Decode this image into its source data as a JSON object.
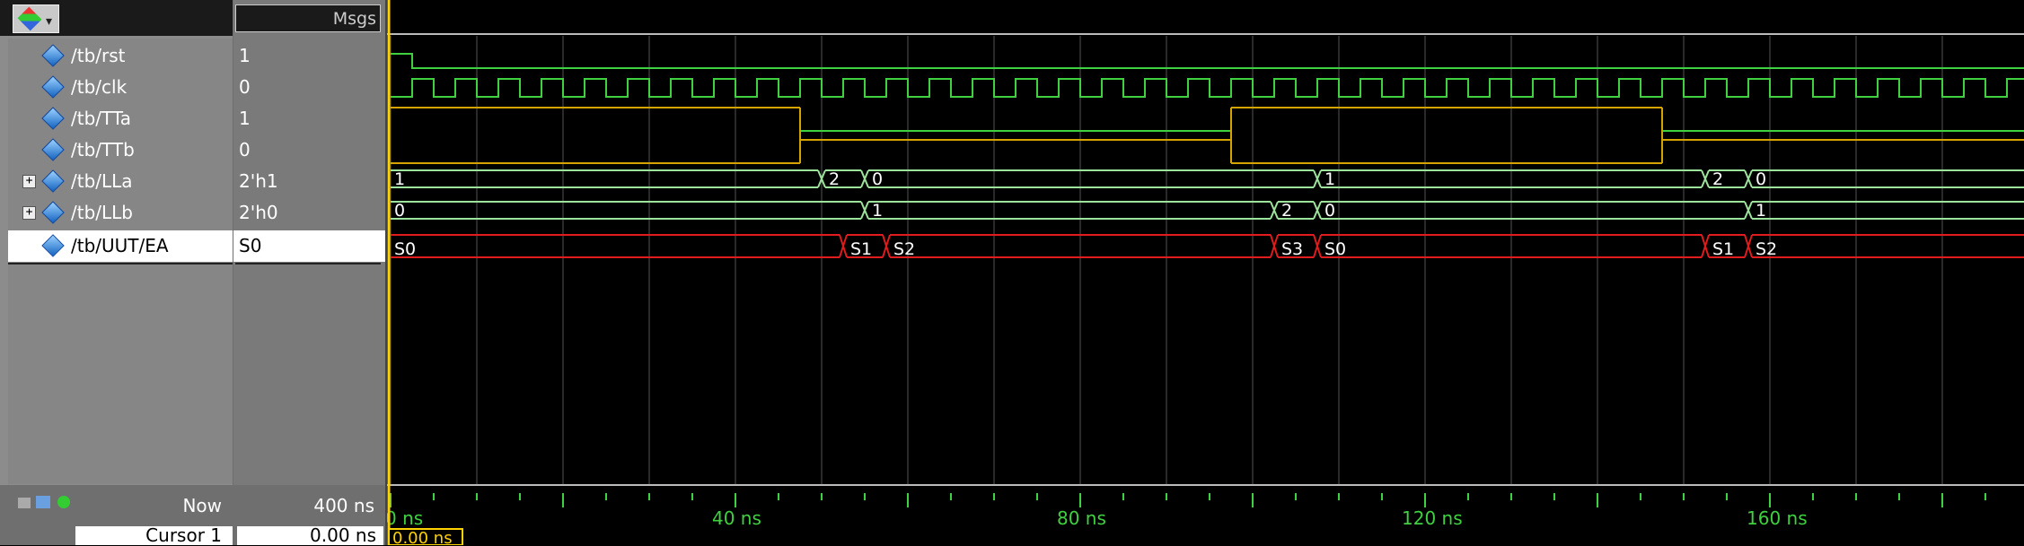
{
  "toolbar": {
    "icon": "wave-tool-icon"
  },
  "value_header": "Msgs",
  "signals": [
    {
      "name": "/tb/rst",
      "value": "1",
      "expandable": false
    },
    {
      "name": "/tb/clk",
      "value": "0",
      "expandable": false
    },
    {
      "name": "/tb/TTa",
      "value": "1",
      "expandable": false
    },
    {
      "name": "/tb/TTb",
      "value": "0",
      "expandable": false
    },
    {
      "name": "/tb/LLa",
      "value": "2'h1",
      "expandable": true
    },
    {
      "name": "/tb/LLb",
      "value": "2'h0",
      "expandable": true
    },
    {
      "name": "/tb/UUT/EA",
      "value": "S0",
      "expandable": false,
      "selected": true
    }
  ],
  "bus_labels": {
    "LLa": [
      {
        "t": 0,
        "v": "1"
      },
      {
        "t": 50,
        "v": "2"
      },
      {
        "t": 55,
        "v": "0"
      },
      {
        "t": 107.5,
        "v": "1"
      },
      {
        "t": 152.5,
        "v": "2"
      },
      {
        "t": 157.5,
        "v": "0"
      }
    ],
    "LLb": [
      {
        "t": 0,
        "v": "0"
      },
      {
        "t": 55,
        "v": "1"
      },
      {
        "t": 102.5,
        "v": "2"
      },
      {
        "t": 107.5,
        "v": "0"
      },
      {
        "t": 157.5,
        "v": "1"
      }
    ],
    "EA": [
      {
        "t": 0,
        "v": "S0"
      },
      {
        "t": 52.5,
        "v": "S1"
      },
      {
        "t": 57.5,
        "v": "S2"
      },
      {
        "t": 102.5,
        "v": "S3"
      },
      {
        "t": 107.5,
        "v": "S0"
      },
      {
        "t": 152.5,
        "v": "S1"
      },
      {
        "t": 157.5,
        "v": "S2"
      }
    ]
  },
  "status": {
    "now_label": "Now",
    "now_value": "400 ns",
    "cursor_label": "Cursor 1",
    "cursor_value": "0.00 ns",
    "cursor_time_tag": "0.00 ns"
  },
  "timeline": {
    "unit": "ns",
    "major_ticks": [
      {
        "t": 0,
        "label": "0 ns"
      },
      {
        "t": 40,
        "label": "40 ns"
      },
      {
        "t": 80,
        "label": "80 ns"
      },
      {
        "t": 120,
        "label": "120 ns"
      },
      {
        "t": 160,
        "label": "160 ns"
      }
    ]
  },
  "colors": {
    "logic": "#3fd13f",
    "analog_yellow": "#d6a400",
    "bus": "#9ce49c",
    "state": "#e01c1c",
    "cursor": "#ffd200",
    "grid": "#555555"
  }
}
